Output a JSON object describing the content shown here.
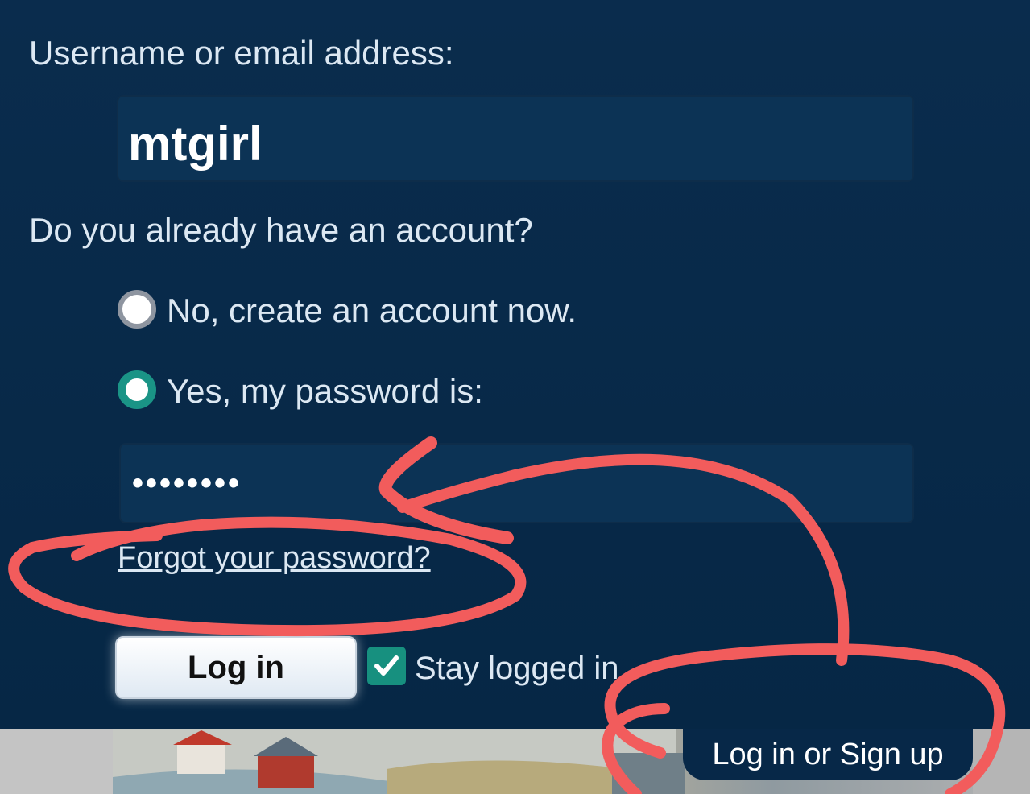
{
  "form": {
    "username_label": "Username or email address:",
    "username_value": "mtgirl",
    "account_question": "Do you already have an account?",
    "option_no": "No, create an account now.",
    "option_yes": "Yes, my password is:",
    "option_yes_selected": true,
    "password_value": "••••••••",
    "forgot_password": "Forgot your password?",
    "login_button": "Log in",
    "stay_logged_in": "Stay logged in",
    "stay_logged_in_checked": true
  },
  "footer": {
    "signup_label": "Log in or Sign up"
  },
  "colors": {
    "background": "#072848",
    "field": "#0c3355",
    "accent": "#1a9486",
    "annotation": "#f05a5a"
  },
  "icons": {
    "checkbox": "check-icon",
    "annotations": [
      "hand-drawn-arrow",
      "hand-drawn-circle"
    ]
  }
}
